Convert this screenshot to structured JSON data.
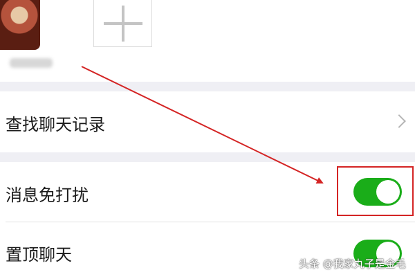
{
  "members": {
    "avatar_icon": "person-avatar",
    "add_icon": "plus-icon"
  },
  "settings": {
    "search_history": {
      "label": "查找聊天记录",
      "icon": "chevron-right-icon"
    },
    "mute_notifications": {
      "label": "消息免打扰",
      "enabled": true
    },
    "pin_chat": {
      "label": "置顶聊天",
      "enabled": true
    }
  },
  "annotation": {
    "color": "#d42424"
  },
  "watermark": {
    "text": "头条 @我家丸子是金毛"
  },
  "colors": {
    "toggle_on": "#1aad19",
    "section_gap": "#efeff4",
    "annotation_red": "#d42424"
  }
}
